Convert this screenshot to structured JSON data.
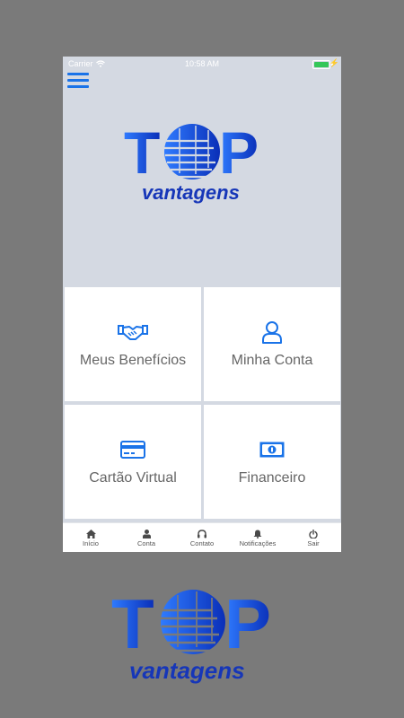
{
  "status": {
    "carrier": "Carrier",
    "time": "10:58 AM"
  },
  "logo": {
    "letter_t": "T",
    "letter_p": "P",
    "tagline": "vantagens"
  },
  "tiles": [
    {
      "label": "Meus Benefícios",
      "icon": "handshake-icon"
    },
    {
      "label": "Minha Conta",
      "icon": "user-icon"
    },
    {
      "label": "Cartão Virtual",
      "icon": "credit-card-icon"
    },
    {
      "label": "Financeiro",
      "icon": "money-icon"
    }
  ],
  "tabs": [
    {
      "label": "Início",
      "icon": "home-icon"
    },
    {
      "label": "Conta",
      "icon": "person-icon"
    },
    {
      "label": "Contato",
      "icon": "headset-icon"
    },
    {
      "label": "Notificações",
      "icon": "bell-icon"
    },
    {
      "label": "Sair",
      "icon": "power-icon"
    }
  ],
  "colors": {
    "accent": "#1a73e8",
    "background": "#d4d9e2",
    "outer": "#7a7a7a"
  }
}
